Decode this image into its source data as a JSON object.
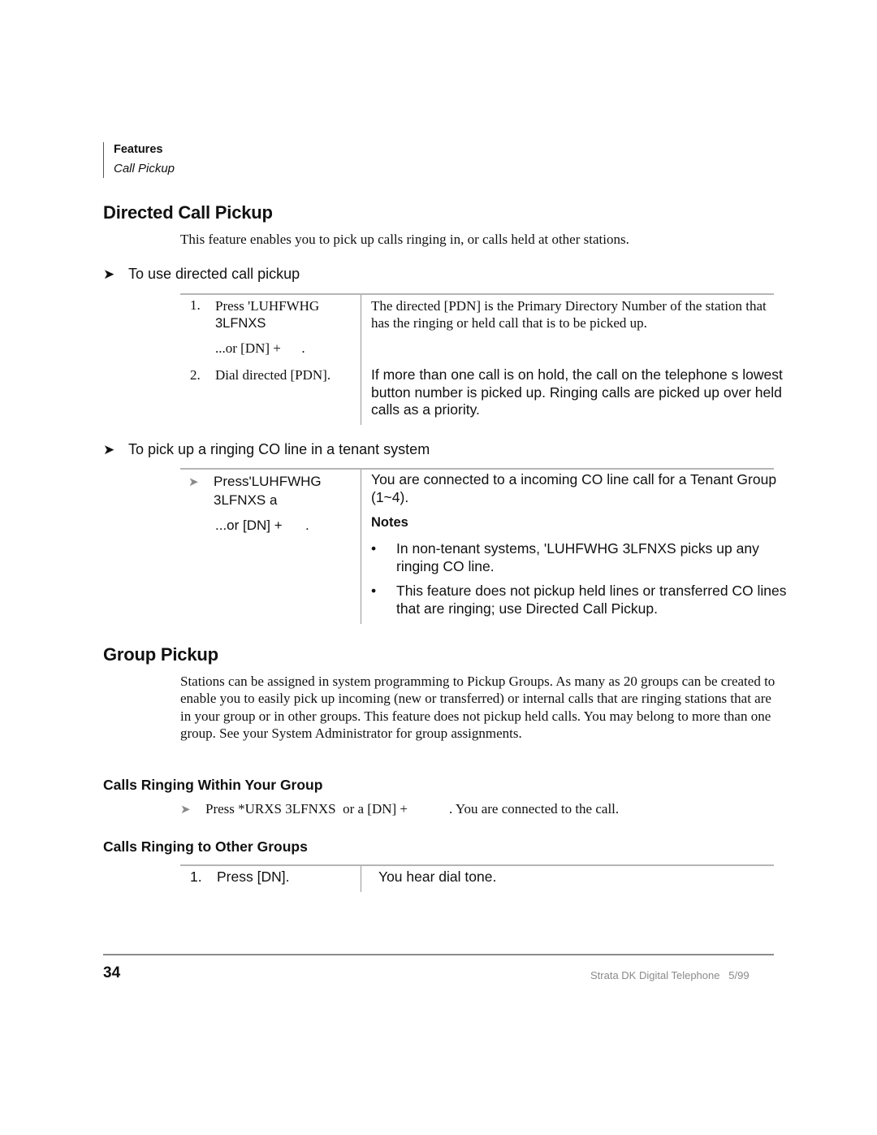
{
  "header": {
    "section": "Features",
    "subsection": "Call Pickup"
  },
  "directed": {
    "title": "Directed Call Pickup",
    "intro": "This feature enables you to pick up calls ringing in, or calls held at other stations.",
    "procedure_icon": "arrow-right-icon",
    "procedure_title": "To use directed call pickup",
    "steps": [
      {
        "num": "1.",
        "action_line1": "Press 'LUHFWHG",
        "action_line2": "3LFNXS",
        "action_alt": "...or [DN] +      .",
        "result": "The directed [PDN] is the Primary Directory Number of the station that has the ringing or held call that is to be picked up."
      },
      {
        "num": "2.",
        "action_line1": "Dial directed [PDN].",
        "result": "If more than one call is on hold, the call on the telephone s lowest button number is picked up. Ringing calls are picked up over held calls as a priority."
      }
    ]
  },
  "tenant": {
    "procedure_title": "To pick up a ringing CO line in a tenant system",
    "step": {
      "action_line1": "Press'LUHFWHG",
      "action_line2": "3LFNXS  a",
      "action_alt": "...or [DN] +      .",
      "result": "You are connected to a incoming CO line call for a Tenant Group (1~4).",
      "notes_title": "Notes",
      "notes": [
        "In non-tenant systems, 'LUHFWHG 3LFNXS picks up any ringing CO line.",
        "This feature does not pickup held lines or transferred CO lines that are ringing; use Directed Call Pickup."
      ]
    }
  },
  "group": {
    "title": "Group Pickup",
    "intro": "Stations can be assigned in system programming to Pickup Groups. As many as 20 groups can be created to enable you to easily pick up incoming (new or transferred) or internal calls that are ringing stations that are in your group or in other groups. This feature does not pickup held calls. You may belong to more than one group. See your System Administrator for group assignments.",
    "within": {
      "title": "Calls Ringing Within Your Group",
      "step": "Press *URXS 3LFNXS  or a [DN] +            . You are connected to the call."
    },
    "other": {
      "title": "Calls Ringing to Other Groups",
      "steps": [
        {
          "num": "1.",
          "action": "Press [DN].",
          "result": "You hear dial tone."
        }
      ]
    }
  },
  "footer": {
    "page_number": "34",
    "doc_title": "Strata DK Digital Telephone   5/99"
  }
}
